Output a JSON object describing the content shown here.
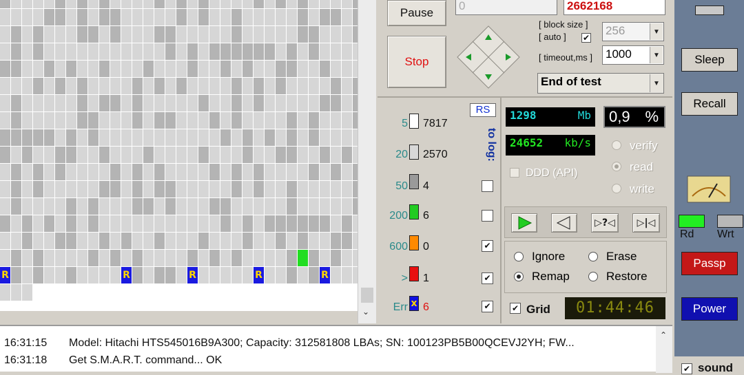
{
  "controls": {
    "pause_label": "Pause",
    "stop_label": "Stop",
    "start_lba": "0",
    "end_lba": "2662168",
    "block_size_label": "[ block size ]",
    "auto_label": "[ auto ]",
    "block_size_value": "256",
    "timeout_label": "[ timeout,ms ]",
    "timeout_value": "1000",
    "end_action": "End of test"
  },
  "legend": {
    "rs_label": "RS",
    "to_log_label": "to log:",
    "rows": [
      {
        "threshold": "5",
        "count": "7817",
        "color": "#ffffff"
      },
      {
        "threshold": "20",
        "count": "2570",
        "color": "#d8d8d8"
      },
      {
        "threshold": "50",
        "count": "4",
        "color": "#9a9a9a"
      },
      {
        "threshold": "200",
        "count": "6",
        "color": "#22cc22"
      },
      {
        "threshold": "600",
        "count": "0",
        "color": "#ff8a00"
      },
      {
        "threshold": ">",
        "count": "1",
        "color": "#e81010"
      },
      {
        "threshold": "Err",
        "count": "6",
        "color": "#1010e0"
      }
    ]
  },
  "stats": {
    "mb_value": "1298",
    "mb_unit": "Mb",
    "percent_value": "0,9",
    "percent_unit": "%",
    "speed_value": "24652",
    "speed_unit": "kb/s",
    "ddd_label": "DDD (API)",
    "mode_verify": "verify",
    "mode_read": "read",
    "mode_write": "write",
    "timer": "01:44:46"
  },
  "actions": {
    "ignore": "Ignore",
    "erase": "Erase",
    "remap": "Remap",
    "restore": "Restore",
    "grid_label": "Grid"
  },
  "right": {
    "sleep": "Sleep",
    "recall": "Recall",
    "rd": "Rd",
    "wrt": "Wrt",
    "passp": "Passp",
    "power": "Power",
    "sound": "sound"
  },
  "log": [
    {
      "time": "16:31:15",
      "text": "Model: Hitachi HTS545016B9A300; Capacity: 312581808 LBAs; SN: 100123PB5B00QCEVJ2YH; FW..."
    },
    {
      "time": "16:31:18",
      "text": "Get S.M.A.R.T. command... OK"
    }
  ],
  "colors": {
    "accent_green": "#22dd22",
    "error_blue": "#1a1ae0",
    "stop_text": "#e01010",
    "passp_bg": "#c41818",
    "power_bg": "#1010b0"
  }
}
